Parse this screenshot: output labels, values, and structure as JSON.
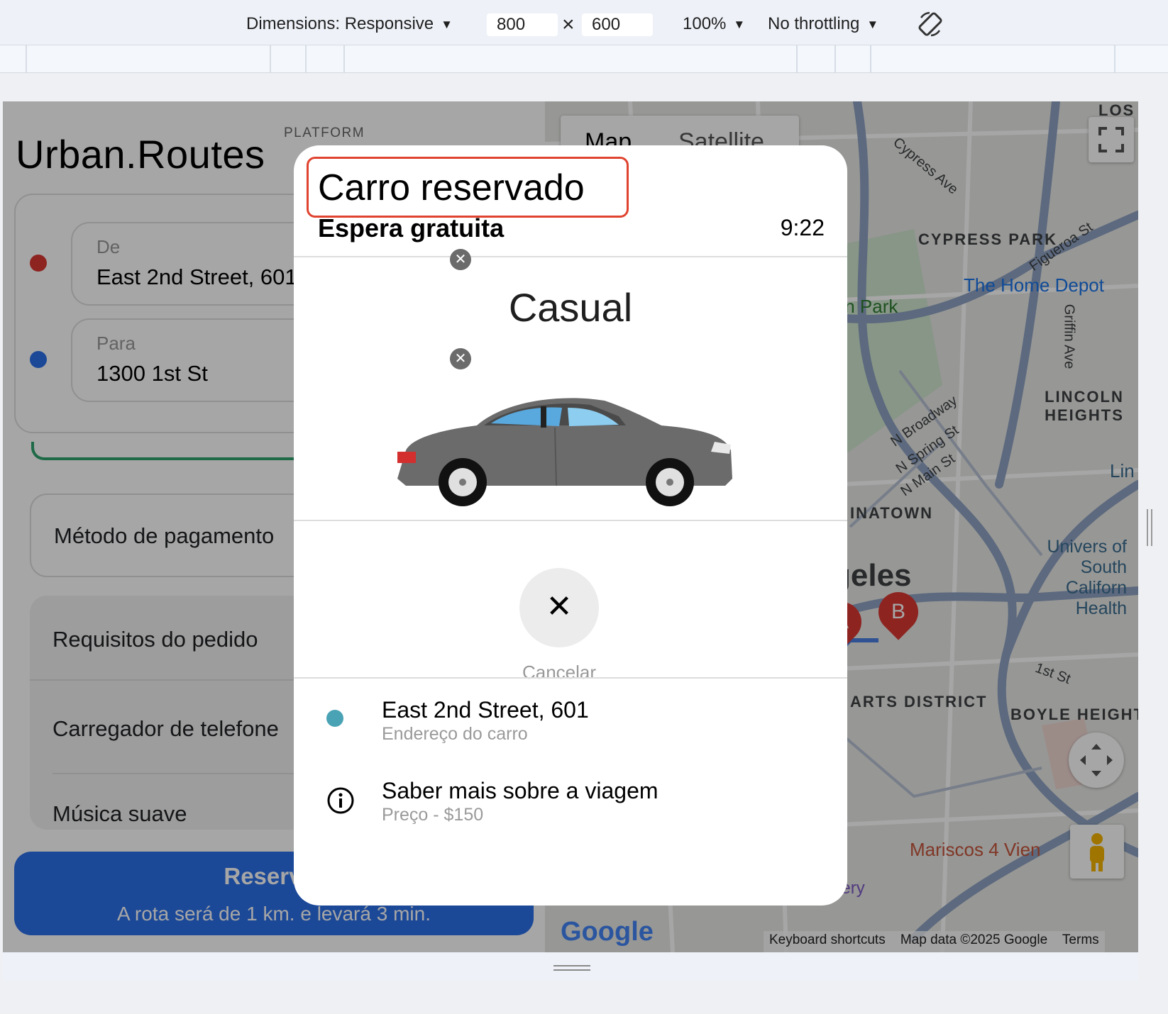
{
  "devtools": {
    "dimensions_label": "Dimensions: Responsive",
    "width": "800",
    "height": "600",
    "times": "×",
    "zoom": "100%",
    "throttling": "No throttling"
  },
  "app": {
    "brand": "Urban.Routes",
    "platform": "PLATFORM",
    "from": {
      "label": "De",
      "value": "East 2nd Street, 601"
    },
    "to": {
      "label": "Para",
      "value": "1300 1st St"
    },
    "payment_method": "Método de pagamento",
    "requirements": {
      "title": "Requisitos do pedido",
      "items": [
        "Carregador de telefone",
        "Música suave"
      ]
    },
    "reserve_button": {
      "label": "Reservar",
      "route_info": "A rota será de 1 km. e levará 3 min."
    }
  },
  "map": {
    "tabs": [
      "Map",
      "Satellite"
    ],
    "labels": [
      "CYPRESS PARK",
      "LINCOLN HEIGHTS",
      "INATOWN",
      "ARTS DISTRICT",
      "BOYLE HEIGHTS",
      "LOS A"
    ],
    "streets": [
      "Cypress Ave",
      "Figueroa St",
      "Griffin Ave",
      "N Broadway",
      "N Spring St",
      "N Main St",
      "1st St"
    ],
    "pois": [
      "The Home Depot",
      "Mariscos 4 Vien",
      "Night Gallery",
      "Univers of South Californ Health",
      "ian Park",
      "geles",
      "Lin"
    ],
    "markers": [
      "A",
      "B"
    ],
    "logo": "Google",
    "attribution": [
      "Keyboard shortcuts",
      "Map data ©2025 Google",
      "Terms"
    ]
  },
  "modal": {
    "title": "Carro reservado",
    "subtitle": "Espera gratuita",
    "timer": "9:22",
    "tariff": "Casual",
    "cancel_label": "Cancelar",
    "rows": [
      {
        "icon": "teal-dot-icon",
        "main": "East 2nd Street, 601",
        "secondary": "Endereço do carro"
      },
      {
        "icon": "info-icon",
        "main": "Saber mais sobre a viagem",
        "secondary": "Preço - $150"
      }
    ]
  },
  "colors": {
    "accent": "#2a6fe8",
    "highlight": "#e0432f",
    "from_dot": "#d93832",
    "to_dot": "#2a6fe8",
    "car_dot": "#4aa3b5"
  }
}
